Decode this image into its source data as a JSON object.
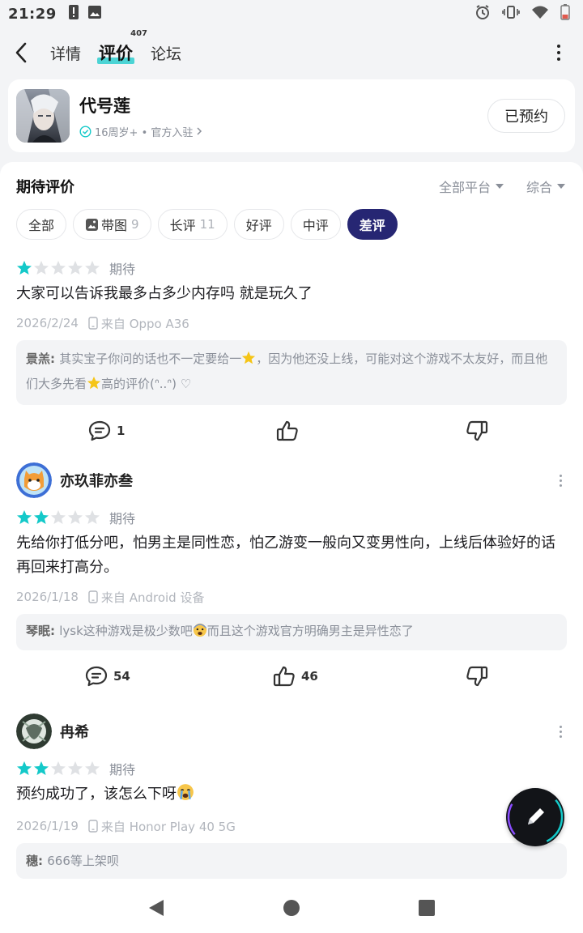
{
  "status_bar": {
    "time": "21:29"
  },
  "nav": {
    "tabs": [
      {
        "label": "详情",
        "active": false
      },
      {
        "label": "评价",
        "active": true,
        "badge": "407"
      },
      {
        "label": "论坛",
        "active": false
      }
    ]
  },
  "game": {
    "name": "代号莲",
    "meta": "16周岁+ • 官方入驻",
    "reserve_label": "已预约"
  },
  "panel": {
    "title": "期待评价",
    "platform_filter": "全部平台",
    "sort_filter": "综合"
  },
  "chips": [
    {
      "label": "全部"
    },
    {
      "label": "带图",
      "count": "9"
    },
    {
      "label": "长评",
      "count": "11"
    },
    {
      "label": "好评"
    },
    {
      "label": "中评"
    },
    {
      "label": "差评",
      "active": true
    }
  ],
  "reviews": [
    {
      "rating": 1,
      "rating_label": "期待",
      "text": "大家可以告诉我最多占多少内存吗 就是玩久了",
      "date": "2026/2/24",
      "device": "来自 Oppo A36",
      "reply": {
        "user": "景羔",
        "text_a": "其实宝子你问的话也不一定要给一",
        "text_b": "，因为他还没上线，可能对这个游戏不太友好，而且他们大多先看",
        "text_c": "高的评价(ᐢ..ᐢ) ♡"
      },
      "comments": "1",
      "likes": ""
    },
    {
      "user": "亦玖菲亦叁",
      "rating": 2,
      "rating_label": "期待",
      "text": "先给你打低分吧，怕男主是同性恋，怕乙游变一般向又变男性向，上线后体验好的话再回来打高分。",
      "date": "2026/1/18",
      "device": "来自 Android 设备",
      "reply": {
        "user": "琴眠",
        "text_a": "lysk这种游戏是极少数吧",
        "text_b": "而且这个游戏官方明确男主是异性恋了"
      },
      "comments": "54",
      "likes": "46"
    },
    {
      "user": "冉希",
      "rating": 2,
      "rating_label": "期待",
      "text": "预约成功了，该怎么下呀",
      "date": "2026/1/19",
      "device": "来自 Honor Play 40 5G",
      "reply": {
        "user": "穗",
        "text_a": "666等上架呗"
      }
    }
  ],
  "colors": {
    "star_on": "#14c9c9",
    "star_off": "#dfe1e4",
    "chip_active": "#262673",
    "accent": "#14c9c9"
  }
}
